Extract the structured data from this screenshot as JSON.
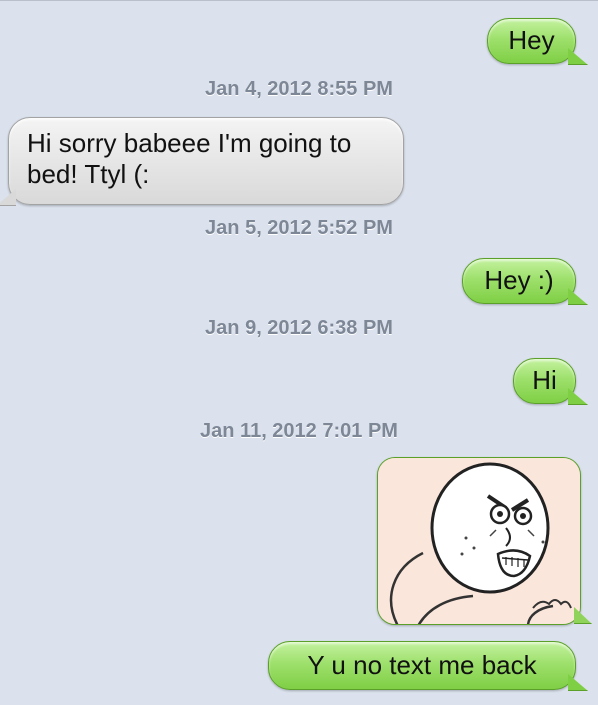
{
  "conversation": {
    "messages": [
      {
        "direction": "sent",
        "text": "Hey"
      },
      {
        "timestamp": "Jan 4, 2012 8:55 PM"
      },
      {
        "direction": "received",
        "text": "Hi sorry babeee I'm going to bed! Ttyl (:"
      },
      {
        "timestamp": "Jan 5, 2012 5:52 PM"
      },
      {
        "direction": "sent",
        "text": "Hey :)"
      },
      {
        "timestamp": "Jan 9, 2012 6:38 PM"
      },
      {
        "direction": "sent",
        "text": "Hi"
      },
      {
        "timestamp": "Jan 11, 2012 7:01 PM"
      },
      {
        "direction": "sent",
        "type": "image",
        "image": "y-u-no-rage-face"
      },
      {
        "direction": "sent",
        "text": "Y u no text me back"
      }
    ],
    "colors": {
      "sent_bubble": "#9ee06c",
      "received_bubble": "#e6e6e6",
      "background": "#dbe2ed",
      "timestamp_text": "#7d8796"
    }
  }
}
